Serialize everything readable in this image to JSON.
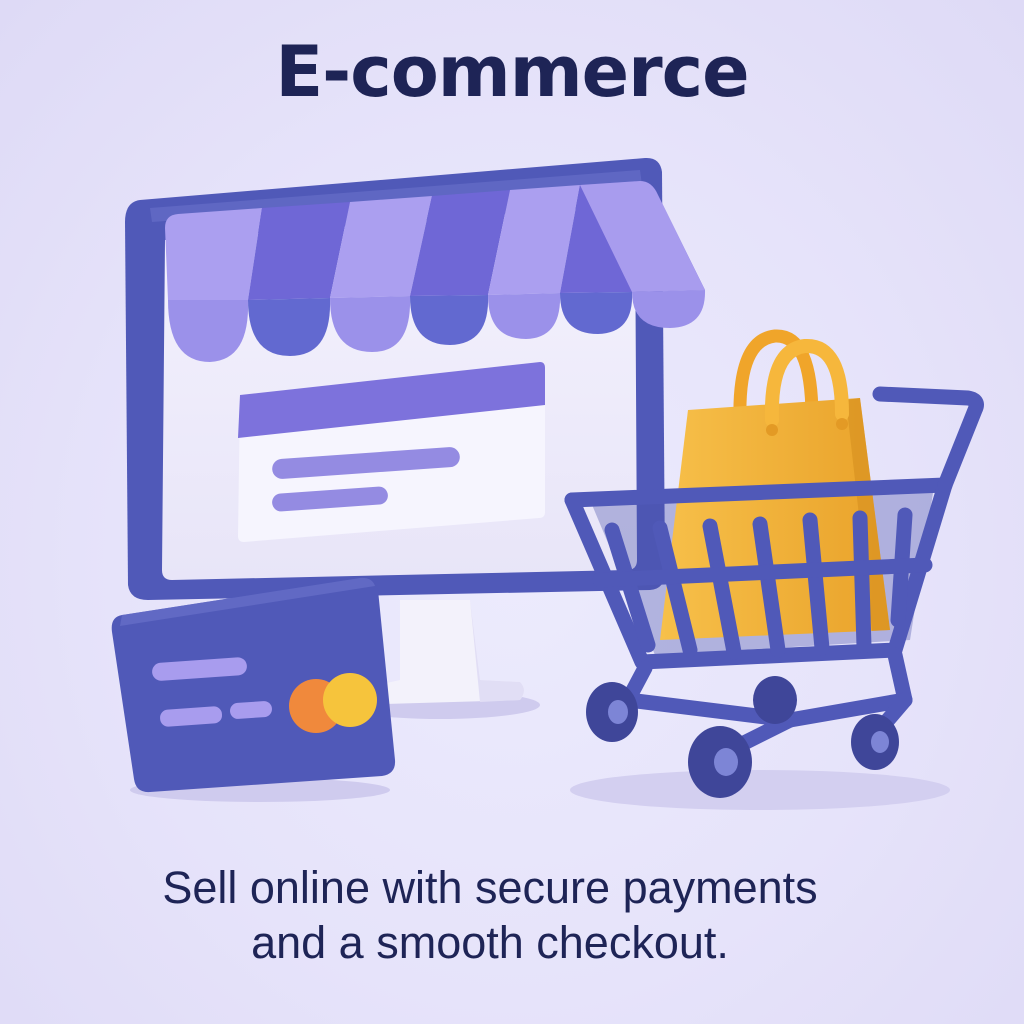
{
  "heading": "E-commerce",
  "tagline": {
    "line1": "Sell online with secure payments",
    "line2": "and a smooth checkout."
  },
  "illustration": {
    "items": [
      "storefront-monitor-icon",
      "credit-card-icon",
      "shopping-cart-icon",
      "shopping-bag-icon"
    ]
  },
  "colors": {
    "background": "#e8e5fb",
    "text": "#1e2456",
    "primary": "#5059b8",
    "awning_light": "#ab9ff0",
    "awning_dark": "#6f67d6",
    "bag": "#f6b73c",
    "card_orange": "#f0893c",
    "card_yellow": "#f6c43c"
  }
}
